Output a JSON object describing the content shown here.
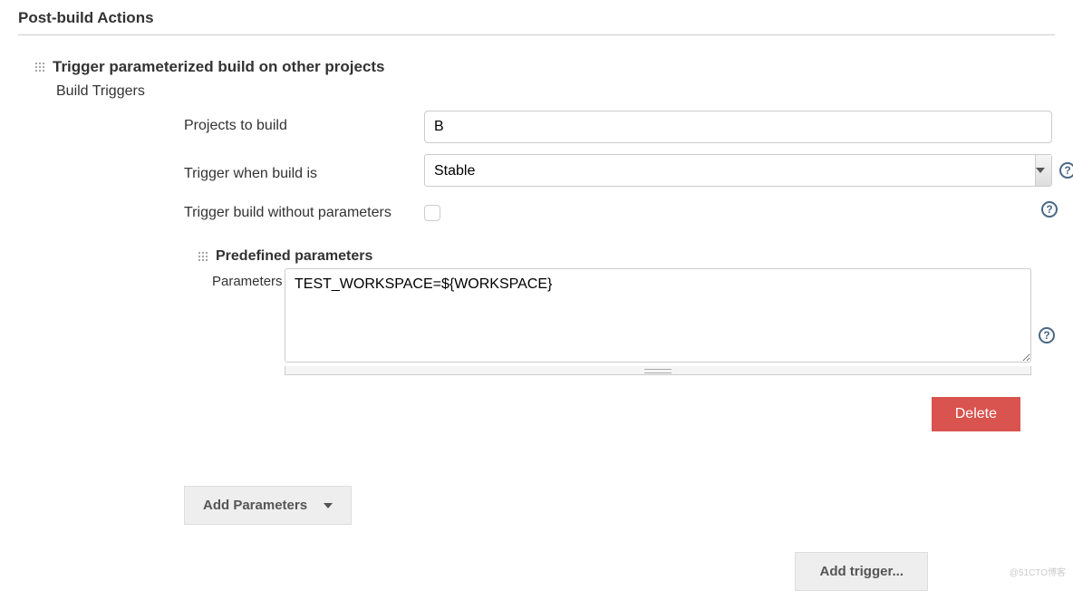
{
  "section": {
    "title": "Post-build Actions"
  },
  "trigger_block": {
    "title": "Trigger parameterized build on other projects",
    "subtitle": "Build Triggers",
    "fields": {
      "projects_label": "Projects to build",
      "projects_value": "B",
      "trigger_when_label": "Trigger when build is",
      "trigger_when_value": "Stable",
      "trigger_without_label": "Trigger build without parameters"
    }
  },
  "predefined": {
    "title": "Predefined parameters",
    "params_label": "Parameters",
    "params_value": "TEST_WORKSPACE=${WORKSPACE}"
  },
  "buttons": {
    "delete": "Delete",
    "add_parameters": "Add Parameters",
    "add_trigger": "Add trigger..."
  },
  "watermark": "@51CTO博客"
}
